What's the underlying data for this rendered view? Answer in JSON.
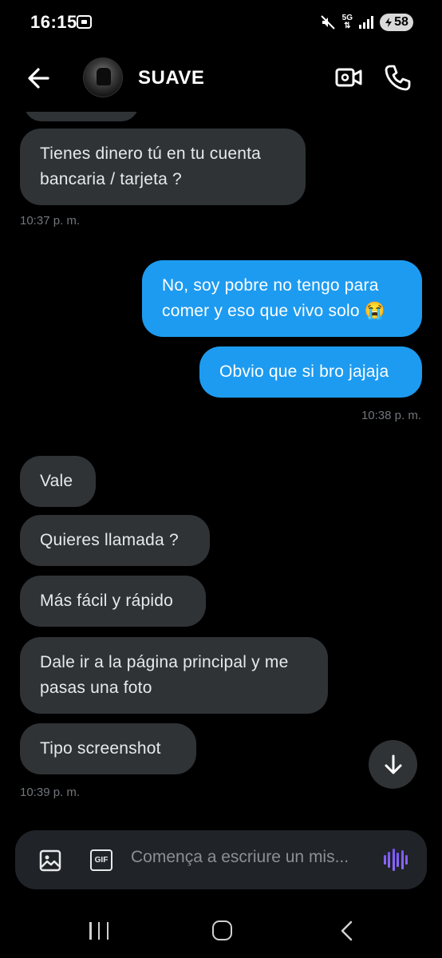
{
  "status_bar": {
    "time": "16:15",
    "network": "5G",
    "battery": "58"
  },
  "header": {
    "contact_name": "SUAVE"
  },
  "messages": [
    {
      "direction": "in",
      "lines": [
        "Tienes dinero tú en tu cuenta",
        "bancaria / tarjeta ?"
      ]
    },
    {
      "direction": "out",
      "lines": [
        "No, soy pobre no tengo para",
        "comer y eso que vivo solo 😭"
      ]
    },
    {
      "direction": "out",
      "lines": [
        "Obvio que si bro jajaja"
      ]
    },
    {
      "direction": "in",
      "lines": [
        "Vale"
      ]
    },
    {
      "direction": "in",
      "lines": [
        "Quieres llamada ?"
      ]
    },
    {
      "direction": "in",
      "lines": [
        "Más fácil y rápido"
      ]
    },
    {
      "direction": "in",
      "lines": [
        "Dale ir a la página principal y me",
        "pasas una foto"
      ]
    },
    {
      "direction": "in",
      "lines": [
        "Tipo screenshot"
      ]
    }
  ],
  "timestamps": [
    "10:37 p. m.",
    "10:38 p. m.",
    "10:39 p. m."
  ],
  "composer": {
    "placeholder": "Comença a escriure un mis...",
    "gif_label": "GIF"
  },
  "icons": {
    "back": "arrow-left-icon",
    "video": "video-camera-icon",
    "call": "phone-icon",
    "scroll": "arrow-down-icon",
    "image": "image-icon",
    "gif": "gif-icon",
    "voice": "voice-wave-icon"
  },
  "colors": {
    "background": "#000000",
    "incoming_bubble": "#2f3336",
    "outgoing_bubble": "#1d9bf0",
    "timestamp": "#71767b",
    "composer": "#202327",
    "voice_accent": "#7856ff"
  }
}
